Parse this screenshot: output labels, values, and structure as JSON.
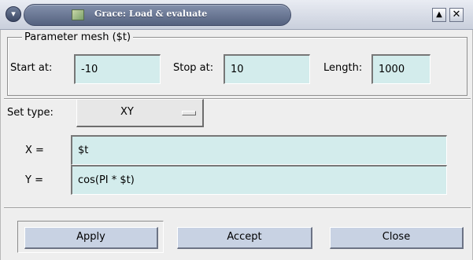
{
  "window": {
    "title": "Grace: Load & evaluate",
    "menu_glyph": "▾",
    "shade_glyph": "▲",
    "close_glyph": "✕"
  },
  "parameter_mesh": {
    "legend": "Parameter mesh ($t)",
    "start_label": "Start at:",
    "start_value": "-10",
    "stop_label": "Stop at:",
    "stop_value": "10",
    "length_label": "Length:",
    "length_value": "1000"
  },
  "set_type": {
    "label": "Set type:",
    "value": "XY"
  },
  "formulas": {
    "x_label": "X =",
    "x_value": "$t",
    "y_label": "Y =",
    "y_value": "cos(PI * $t)"
  },
  "buttons": {
    "apply": "Apply",
    "accept": "Accept",
    "close": "Close"
  }
}
